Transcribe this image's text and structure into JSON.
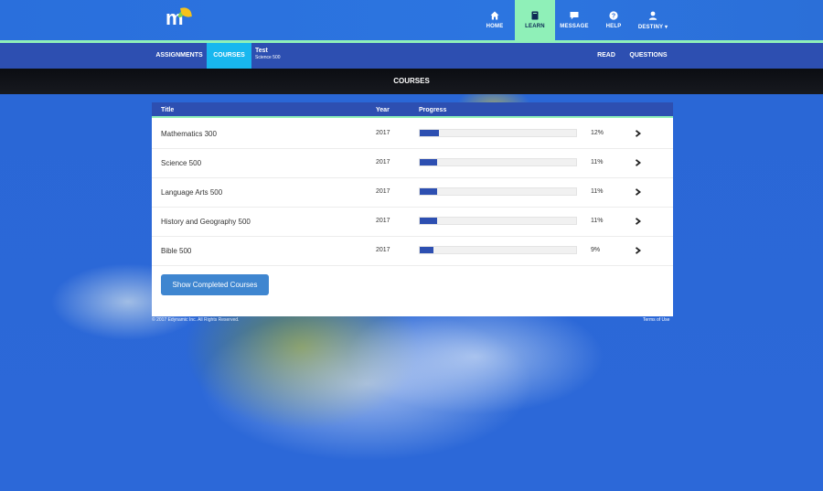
{
  "brand": {
    "logo_text": "m"
  },
  "topnav": [
    {
      "label": "HOME",
      "icon": "home-icon",
      "active": false
    },
    {
      "label": "LEARN",
      "icon": "book-icon",
      "active": true
    },
    {
      "label": "MESSAGE",
      "icon": "message-icon",
      "active": false
    },
    {
      "label": "HELP",
      "icon": "help-icon",
      "active": false
    },
    {
      "label": "DESTINY ▾",
      "icon": "user-icon",
      "active": false
    }
  ],
  "subnav": {
    "assignments": "ASSIGNMENTS",
    "courses": "COURSES",
    "context_title": "Test",
    "context_subtitle": "Science 500",
    "read": "READ",
    "questions": "QUESTIONS"
  },
  "page_title": "COURSES",
  "table": {
    "headers": {
      "title": "Title",
      "year": "Year",
      "progress": "Progress"
    },
    "rows": [
      {
        "title": "Mathematics 300",
        "year": "2017",
        "progress": 12,
        "pct": "12%"
      },
      {
        "title": "Science 500",
        "year": "2017",
        "progress": 11,
        "pct": "11%"
      },
      {
        "title": "Language Arts 500",
        "year": "2017",
        "progress": 11,
        "pct": "11%"
      },
      {
        "title": "History and Geography 500",
        "year": "2017",
        "progress": 11,
        "pct": "11%"
      },
      {
        "title": "Bible 500",
        "year": "2017",
        "progress": 9,
        "pct": "9%"
      }
    ]
  },
  "show_completed_label": "Show Completed Courses",
  "footer": {
    "copyright": "© 2017 Edynamic Inc. All Rights Reserved.",
    "terms": "Terms of Use"
  },
  "colors": {
    "primary_bar": "#2d4fb1",
    "accent_green": "#8ff0b8",
    "active_tab": "#18b7ef",
    "button": "#3f86d0"
  }
}
